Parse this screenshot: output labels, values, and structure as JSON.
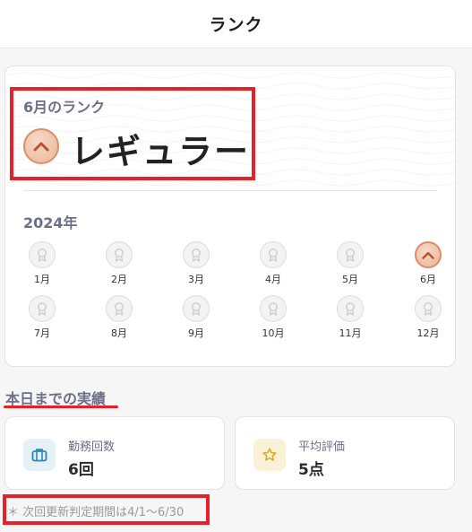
{
  "header": {
    "title": "ランク"
  },
  "rank": {
    "month_label": "6月のランク",
    "name": "レギュラー",
    "icon": "chevron-up-icon",
    "accent_color": "#d98f6a"
  },
  "calendar": {
    "year_label": "2024年",
    "months": [
      {
        "label": "1月",
        "active": false
      },
      {
        "label": "2月",
        "active": false
      },
      {
        "label": "3月",
        "active": false
      },
      {
        "label": "4月",
        "active": false
      },
      {
        "label": "5月",
        "active": false
      },
      {
        "label": "6月",
        "active": true
      },
      {
        "label": "7月",
        "active": false
      },
      {
        "label": "8月",
        "active": false
      },
      {
        "label": "9月",
        "active": false
      },
      {
        "label": "10月",
        "active": false
      },
      {
        "label": "11月",
        "active": false
      },
      {
        "label": "12月",
        "active": false
      }
    ]
  },
  "performance": {
    "section_title": "本日までの実績",
    "stats": [
      {
        "label": "勤務回数",
        "value": "6回",
        "icon": "briefcase-icon",
        "icon_bg": "#e6f1f6",
        "icon_color": "#2b86b7"
      },
      {
        "label": "平均評価",
        "value": "5点",
        "icon": "star-icon",
        "icon_bg": "#fbf1d6",
        "icon_color": "#e0a820"
      }
    ],
    "note": "＊ 次回更新判定期間は4/1〜6/30"
  }
}
